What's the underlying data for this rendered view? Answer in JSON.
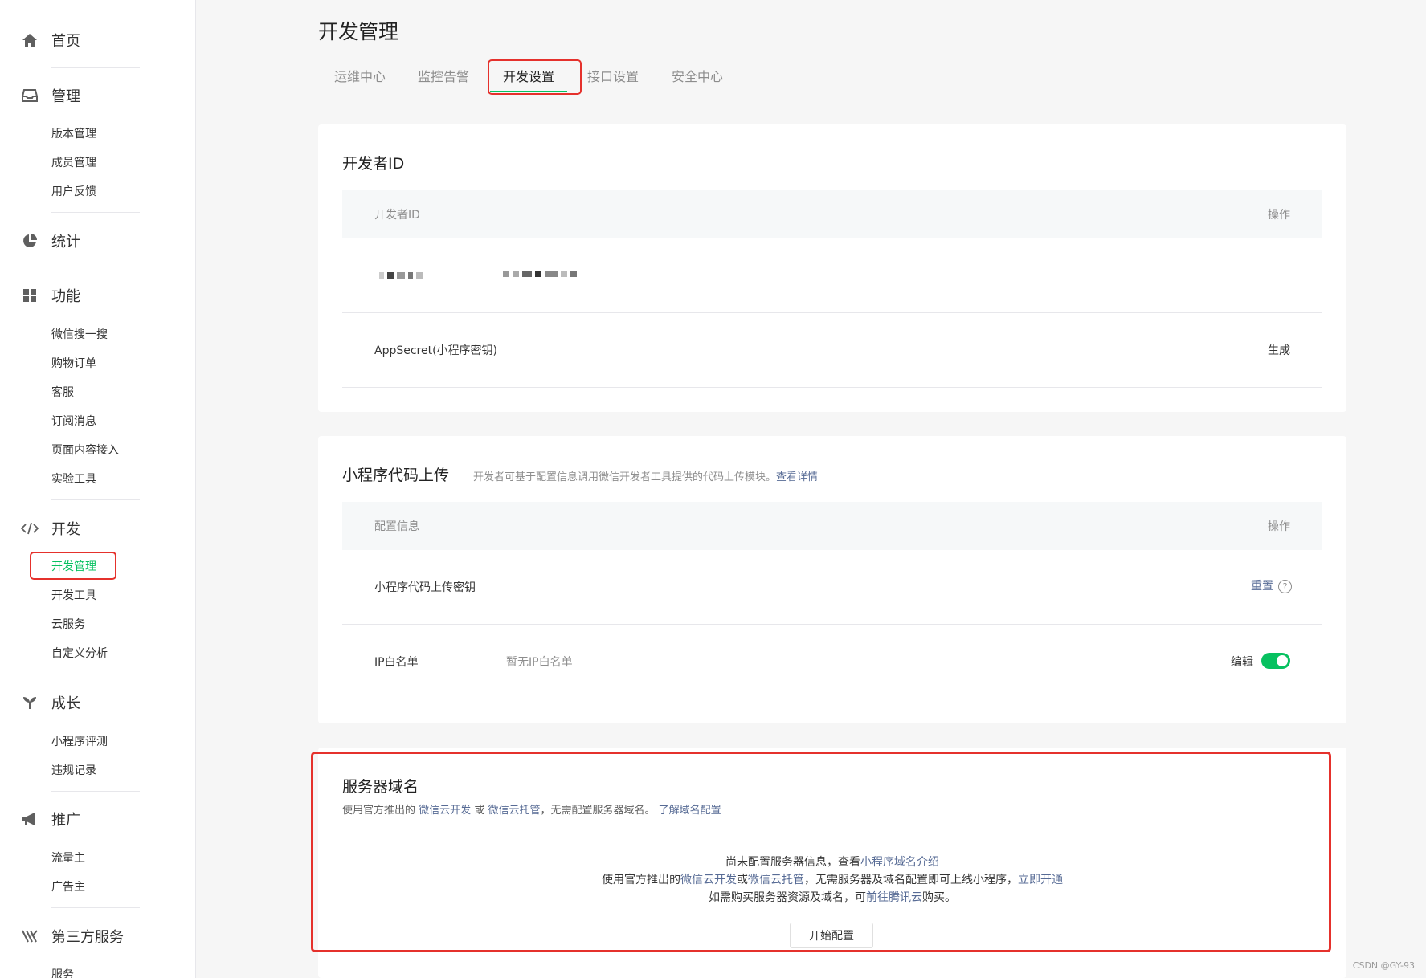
{
  "sidebar": {
    "home": "首页",
    "manage": {
      "label": "管理",
      "items": [
        "版本管理",
        "成员管理",
        "用户反馈"
      ]
    },
    "stats": "统计",
    "features": {
      "label": "功能",
      "items": [
        "微信搜一搜",
        "购物订单",
        "客服",
        "订阅消息",
        "页面内容接入",
        "实验工具"
      ]
    },
    "dev": {
      "label": "开发",
      "items": [
        "开发管理",
        "开发工具",
        "云服务",
        "自定义分析"
      ]
    },
    "growth": {
      "label": "成长",
      "items": [
        "小程序评测",
        "违规记录"
      ]
    },
    "promo": {
      "label": "推广",
      "items": [
        "流量主",
        "广告主"
      ]
    },
    "third": {
      "label": "第三方服务",
      "items": [
        "服务"
      ]
    }
  },
  "page_title": "开发管理",
  "tabs": [
    "运维中心",
    "监控告警",
    "开发设置",
    "接口设置",
    "安全中心"
  ],
  "dev_id": {
    "title": "开发者ID",
    "col_id": "开发者ID",
    "col_action": "操作",
    "secret_label": "AppSecret(小程序密钥)",
    "secret_action": "生成"
  },
  "upload": {
    "title": "小程序代码上传",
    "desc": "开发者可基于配置信息调用微信开发者工具提供的代码上传模块。",
    "desc_link": "查看详情",
    "col_config": "配置信息",
    "col_action": "操作",
    "key_label": "小程序代码上传密钥",
    "key_action": "重置",
    "help": "?",
    "ip_label": "IP白名单",
    "ip_value": "暂无IP白名单",
    "ip_action": "编辑"
  },
  "server": {
    "title": "服务器域名",
    "desc_pre": "使用官方推出的",
    "desc_link1": "微信云开发",
    "desc_or": "或",
    "desc_link2": "微信云托管",
    "desc_post": "，无需配置服务器域名。",
    "desc_link3": "了解域名配置",
    "line1_pre": "尚未配置服务器信息，查看",
    "line1_link": "小程序域名介绍",
    "line2_pre": "使用官方推出的",
    "line2_link1": "微信云开发",
    "line2_or": "或",
    "line2_link2": "微信云托管",
    "line2_mid": "，无需服务器及域名配置即可上线小程序，",
    "line2_link3": "立即开通",
    "line3_pre": "如需购买服务器资源及域名，可",
    "line3_link": "前往腾讯云",
    "line3_post": "购买。",
    "button": "开始配置"
  },
  "watermark": "CSDN @GY-93"
}
